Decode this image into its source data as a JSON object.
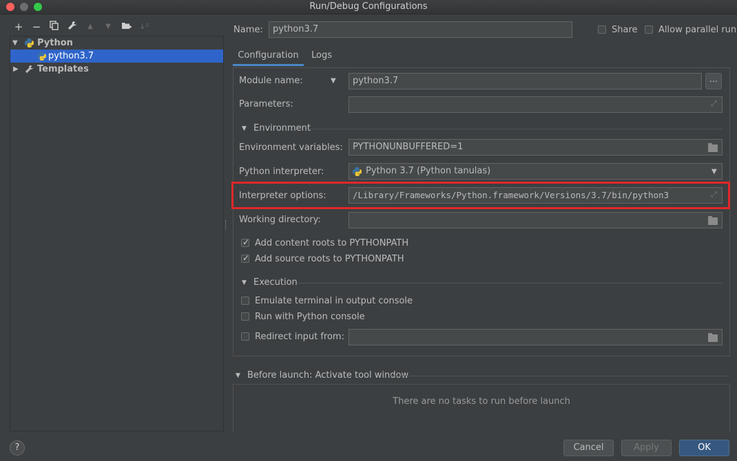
{
  "window": {
    "title": "Run/Debug Configurations"
  },
  "tree": {
    "items": [
      {
        "label": "Python"
      },
      {
        "label": "python3.7"
      },
      {
        "label": "Templates"
      }
    ]
  },
  "header": {
    "name_label": "Name:",
    "name_value": "python3.7",
    "share_label": "Share",
    "parallel_label": "Allow parallel run"
  },
  "tabs": [
    {
      "label": "Configuration"
    },
    {
      "label": "Logs"
    }
  ],
  "form": {
    "module_label": "Module name:",
    "module_value": "python3.7",
    "browse_label": "...",
    "params_label": "Parameters:",
    "params_value": "",
    "env_section": "Environment",
    "envvars_label": "Environment variables:",
    "envvars_value": "PYTHONUNBUFFERED=1",
    "interp_label": "Python interpreter:",
    "interp_value": "Python 3.7 (Python tanulas)",
    "interp_opts_label": "Interpreter options:",
    "interp_opts_value": "/Library/Frameworks/Python.framework/Versions/3.7/bin/python3",
    "workdir_label": "Working directory:",
    "content_roots_label": "Add content roots to PYTHONPATH",
    "source_roots_label": "Add source roots to PYTHONPATH",
    "exec_section": "Execution",
    "emulate_label": "Emulate terminal in output console",
    "pyconsole_label": "Run with Python console",
    "redirect_label": "Redirect input from:"
  },
  "before_launch": {
    "title": "Before launch: Activate tool window",
    "empty": "There are no tasks to run before launch"
  },
  "footer": {
    "help": "?",
    "cancel": "Cancel",
    "apply": "Apply",
    "ok": "OK"
  },
  "colors": {
    "highlight": "#e0272a",
    "selection": "#2f65ca",
    "primary": "#365880"
  }
}
